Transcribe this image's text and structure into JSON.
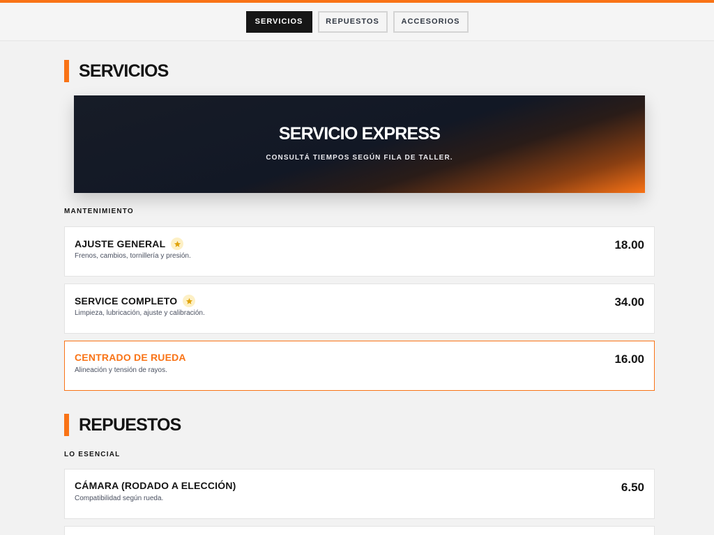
{
  "tabs": [
    {
      "label": "SERVICIOS",
      "active": true
    },
    {
      "label": "REPUESTOS",
      "active": false
    },
    {
      "label": "ACCESORIOS",
      "active": false
    }
  ],
  "colors": {
    "accent": "#f97316",
    "dark": "#161616",
    "star": "#e0a30a"
  },
  "servicios": {
    "title": "SERVICIOS",
    "hero": {
      "title": "SERVICIO EXPRESS",
      "subtitle": "CONSULTÁ TIEMPOS SEGÚN FILA DE TALLER."
    },
    "group_label": "MANTENIMIENTO",
    "items": [
      {
        "name": "AJUSTE GENERAL",
        "desc": "Frenos, cambios, tornillería y presión.",
        "price": "18.00",
        "featured": true,
        "icon": "star-icon"
      },
      {
        "name": "SERVICE COMPLETO",
        "desc": "Limpieza, lubricación, ajuste y calibración.",
        "price": "34.00",
        "featured": true,
        "icon": "star-icon"
      },
      {
        "name": "CENTRADO DE RUEDA",
        "desc": "Alineación y tensión de rayos.",
        "price": "16.00",
        "featured": false,
        "highlighted": true
      }
    ]
  },
  "repuestos": {
    "title": "REPUESTOS",
    "group_label": "LO ESENCIAL",
    "items": [
      {
        "name": "CÁMARA (RODADO A ELECCIÓN)",
        "desc": "Compatibilidad según rueda.",
        "price": "6.50"
      }
    ]
  }
}
